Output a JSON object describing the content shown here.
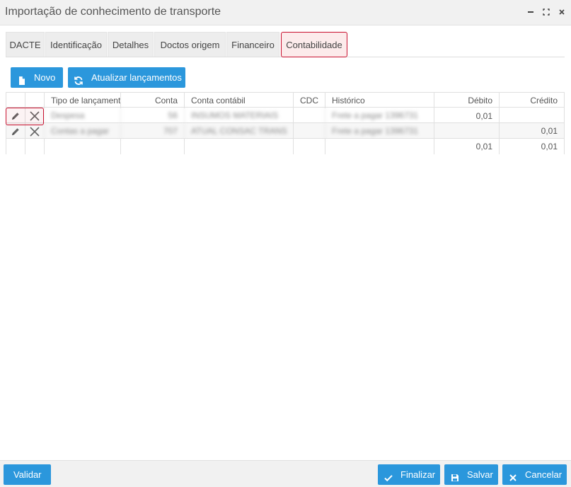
{
  "window": {
    "title": "Importação de conhecimento de transporte"
  },
  "tabs": [
    {
      "label": "DACTE"
    },
    {
      "label": "Identificação"
    },
    {
      "label": "Detalhes"
    },
    {
      "label": "Doctos origem"
    },
    {
      "label": "Financeiro"
    },
    {
      "label": "Contabilidade"
    }
  ],
  "active_tab": "Contabilidade",
  "toolbar": {
    "novo_label": "Novo",
    "atualizar_label": "Atualizar lançamentos"
  },
  "table": {
    "columns": [
      "Tipo de lançamento",
      "Conta",
      "Conta contábil",
      "CDC",
      "Histórico",
      "Débito",
      "Crédito"
    ],
    "rows": [
      {
        "tipo": "Despesa",
        "conta": "56",
        "conta_contabil": "INSUMOS MATERIAIS",
        "cdc": "",
        "historico": "Frete a pagar 1396731",
        "debito": "0,01",
        "credito": ""
      },
      {
        "tipo": "Contas a pagar",
        "conta": "707",
        "conta_contabil": "ATUAL CONSAC TRANS",
        "cdc": "",
        "historico": "Frete a pagar 1396731",
        "debito": "",
        "credito": "0,01"
      }
    ],
    "totals": {
      "debito": "0,01",
      "credito": "0,01"
    }
  },
  "footer": {
    "validar_label": "Validar",
    "finalizar_label": "Finalizar",
    "salvar_label": "Salvar",
    "cancelar_label": "Cancelar"
  },
  "icons": {
    "primary_color": "#2b97dc",
    "highlight_color": "#c8102e"
  }
}
